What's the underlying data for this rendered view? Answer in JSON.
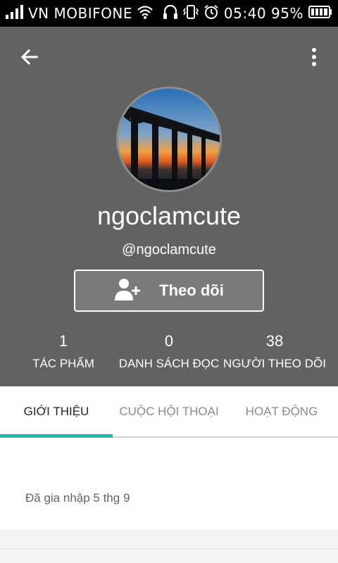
{
  "status_bar": {
    "carrier": "VN MOBIFONE",
    "time": "05:40",
    "battery": "95%",
    "icons": [
      "signal-icon",
      "wifi-icon",
      "headphones-icon",
      "vibrate-icon",
      "alarm-icon",
      "battery-icon"
    ]
  },
  "header": {
    "back_icon": "arrow-back-icon",
    "more_icon": "more-vertical-icon",
    "background_color": "#626262"
  },
  "profile": {
    "display_name": "ngoclamcute",
    "handle": "@ngoclamcute",
    "avatar": "bridge-sunset-photo"
  },
  "follow_button": {
    "label": "Theo dõi",
    "icon": "add-person-icon"
  },
  "stats": [
    {
      "value": "1",
      "label": "TÁC PHẨM"
    },
    {
      "value": "0",
      "label": "DANH SÁCH ĐỌC"
    },
    {
      "value": "38",
      "label": "NGƯỜI THEO DÕI"
    }
  ],
  "tabs": [
    {
      "label": "GIỚI THIỆU",
      "active": true
    },
    {
      "label": "CUỘC HỘI THOẠI",
      "active": false
    },
    {
      "label": "HOẠT ĐỘNG",
      "active": false
    }
  ],
  "about": {
    "joined": "Đã gia nhập 5 thg 9"
  },
  "colors": {
    "accent": "#22b5b5",
    "header": "#626262",
    "status_bar": "#000000"
  }
}
